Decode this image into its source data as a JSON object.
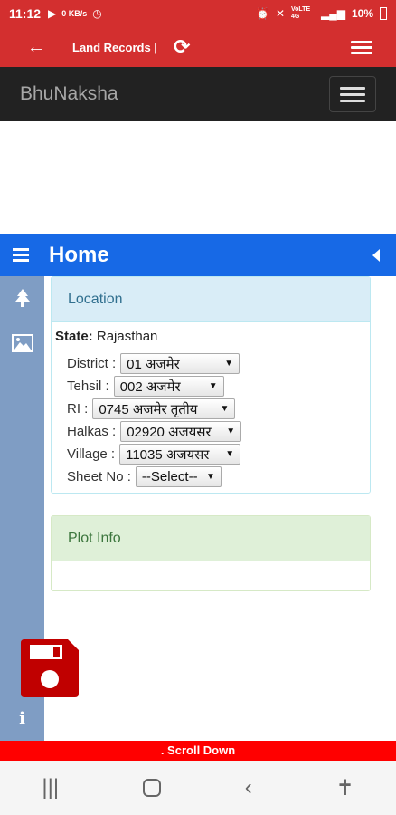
{
  "status": {
    "time": "11:12",
    "net": "0 KB/s",
    "battery": "10%",
    "network_label": "VoLTE 4G",
    "icons_left": [
      "play-icon",
      "data-icon",
      "clock-icon"
    ],
    "icons_right": [
      "alarm-icon",
      "mute-icon",
      "wifi-icon",
      "signal-icon",
      "battery-icon"
    ]
  },
  "appbar": {
    "title": "Land Records |"
  },
  "bhunaksha": {
    "brand": "BhuNaksha"
  },
  "home": {
    "title": "Home"
  },
  "location": {
    "header": "Location",
    "state_label": "State:",
    "state_value": "Rajasthan",
    "fields": [
      {
        "label": "District :",
        "value": "01 अजमेर"
      },
      {
        "label": "Tehsil :",
        "value": "002 अजमेर"
      },
      {
        "label": "RI :",
        "value": "0745 अजमेर तृतीय"
      },
      {
        "label": "Halkas :",
        "value": "02920 अजयसर"
      },
      {
        "label": "Village :",
        "value": "11035 अजयसर"
      },
      {
        "label": "Sheet No :",
        "value": "--Select--"
      }
    ]
  },
  "plot": {
    "header": "Plot Info"
  },
  "scroll_text": ". Scroll Down",
  "colors": {
    "status_red": "#d32f2f",
    "home_blue": "#1769e6",
    "sidenav": "#7f9dc4",
    "save_red": "#c00000"
  }
}
